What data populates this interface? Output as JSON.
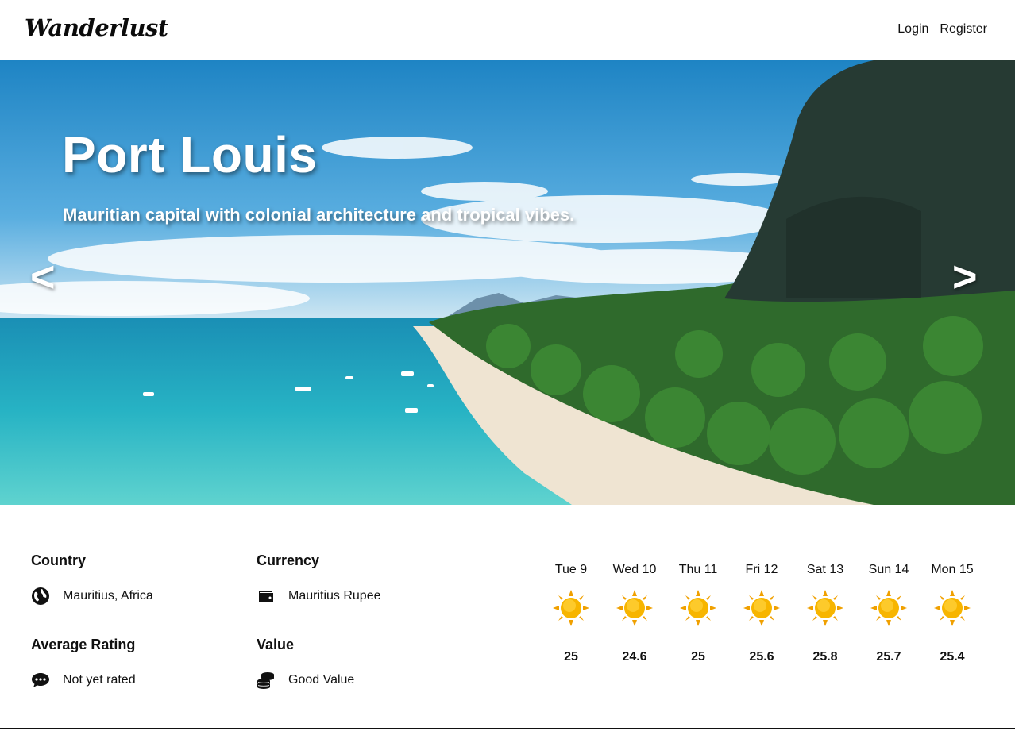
{
  "header": {
    "logo": "Wanderlust",
    "nav": {
      "login": "Login",
      "register": "Register"
    }
  },
  "hero": {
    "title": "Port Louis",
    "subtitle": "Mauritian capital with colonial architecture and tropical vibes.",
    "prev_label": "<",
    "next_label": ">"
  },
  "info": {
    "country": {
      "heading": "Country",
      "value": "Mauritius, Africa",
      "icon": "globe-icon"
    },
    "currency": {
      "heading": "Currency",
      "value": "Mauritius Rupee",
      "icon": "wallet-icon"
    },
    "rating": {
      "heading": "Average Rating",
      "value": "Not yet rated",
      "icon": "comment-dots-icon"
    },
    "value": {
      "heading": "Value",
      "value": "Good Value",
      "icon": "coins-icon"
    }
  },
  "forecast": [
    {
      "day": "Tue 9",
      "temp": "25",
      "icon": "sun-icon"
    },
    {
      "day": "Wed 10",
      "temp": "24.6",
      "icon": "sun-icon"
    },
    {
      "day": "Thu 11",
      "temp": "25",
      "icon": "sun-icon"
    },
    {
      "day": "Fri 12",
      "temp": "25.6",
      "icon": "sun-icon"
    },
    {
      "day": "Sat 13",
      "temp": "25.8",
      "icon": "sun-icon"
    },
    {
      "day": "Sun 14",
      "temp": "25.7",
      "icon": "sun-icon"
    },
    {
      "day": "Mon 15",
      "temp": "25.4",
      "icon": "sun-icon"
    }
  ],
  "colors": {
    "text": "#111111",
    "sun": "#f7b500",
    "sun_rays": "#f0a000"
  }
}
